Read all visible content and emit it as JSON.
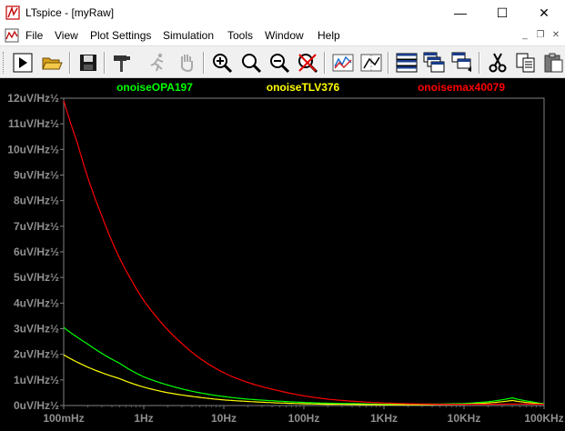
{
  "window": {
    "title": "LTspice - [myRaw]",
    "controls": [
      "—",
      "☐",
      "✕"
    ]
  },
  "menu": {
    "items": [
      "File",
      "View",
      "Plot Settings",
      "Simulation",
      "Tools",
      "Window",
      "Help"
    ],
    "mdi_controls": [
      "_",
      "❐",
      "✕"
    ]
  },
  "toolbar": {
    "buttons": [
      "run",
      "open",
      "save",
      "hammer",
      "running-man",
      "halt-hand",
      "zoom-in",
      "zoom-fit",
      "zoom-out",
      "cancel-zoom",
      "autorange",
      "mark-data",
      "tile-horizontal",
      "cascade",
      "tile-vertical",
      "cut",
      "copy",
      "paste"
    ]
  },
  "chart_data": {
    "type": "line",
    "background": "#000000",
    "xscale": "log",
    "x_tick_labels": [
      "100mHz",
      "1Hz",
      "10Hz",
      "100Hz",
      "1KHz",
      "10KHz",
      "100KHz"
    ],
    "x_tick_values": [
      0.1,
      1,
      10,
      100,
      1000,
      10000,
      100000
    ],
    "y_tick_labels": [
      "0uV/Hz½",
      "1uV/Hz½",
      "2uV/Hz½",
      "3uV/Hz½",
      "4uV/Hz½",
      "5uV/Hz½",
      "6uV/Hz½",
      "7uV/Hz½",
      "8uV/Hz½",
      "9uV/Hz½",
      "10uV/Hz½",
      "11uV/Hz½",
      "12uV/Hz½"
    ],
    "ylim": [
      0,
      12
    ],
    "xlim": [
      0.1,
      100000
    ],
    "grid": false,
    "series": [
      {
        "name": "onoiseOPA197",
        "color": "#00ff00",
        "x": [
          0.1,
          0.2,
          0.5,
          1,
          2,
          5,
          10,
          20,
          50,
          100,
          200,
          500,
          1000,
          2000,
          5000,
          10000,
          20000,
          40000,
          70000,
          100000
        ],
        "values": [
          3.05,
          2.4,
          1.65,
          1.12,
          0.8,
          0.5,
          0.35,
          0.25,
          0.17,
          0.12,
          0.09,
          0.07,
          0.05,
          0.05,
          0.06,
          0.08,
          0.15,
          0.3,
          0.15,
          0.07
        ]
      },
      {
        "name": "onoiseTLV376",
        "color": "#ffff00",
        "x": [
          0.1,
          0.2,
          0.5,
          1,
          2,
          5,
          10,
          20,
          50,
          100,
          200,
          500,
          1000,
          2000,
          5000,
          10000,
          20000,
          40000,
          70000,
          100000
        ],
        "values": [
          1.98,
          1.5,
          1.05,
          0.72,
          0.5,
          0.32,
          0.22,
          0.16,
          0.1,
          0.07,
          0.05,
          0.04,
          0.03,
          0.03,
          0.04,
          0.05,
          0.1,
          0.2,
          0.1,
          0.05
        ]
      },
      {
        "name": "onoisemax40079",
        "color": "#ff0000",
        "x": [
          0.1,
          0.15,
          0.2,
          0.3,
          0.5,
          0.7,
          1,
          1.5,
          2,
          3,
          5,
          7,
          10,
          20,
          50,
          100,
          200,
          500,
          1000,
          2000,
          5000,
          10000,
          20000,
          50000,
          100000
        ],
        "values": [
          11.9,
          10.2,
          8.9,
          7.4,
          5.75,
          4.9,
          4.1,
          3.4,
          2.95,
          2.42,
          1.85,
          1.55,
          1.28,
          0.9,
          0.57,
          0.38,
          0.25,
          0.15,
          0.1,
          0.07,
          0.05,
          0.05,
          0.05,
          0.06,
          0.05
        ]
      }
    ]
  }
}
